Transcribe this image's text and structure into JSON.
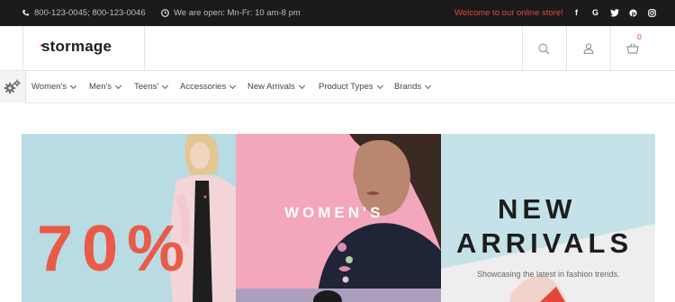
{
  "topbar": {
    "phones": "800-123-0045; 800-123-0046",
    "hours": "We are open: Mn-Fr: 10 am-8 pm",
    "welcome": "Welcome to our online store!",
    "socials": [
      "f",
      "G",
      "twitter",
      "pinterest",
      "instagram"
    ]
  },
  "header": {
    "logo": "stormage",
    "cart_count": "0",
    "icons": [
      "search-icon",
      "user-icon",
      "cart-icon"
    ]
  },
  "nav": {
    "items": [
      "Women's",
      "Men's",
      "Teens'",
      "Accessories",
      "New Arrivals",
      "Product Types",
      "Brands"
    ]
  },
  "banner": {
    "sale": "70%",
    "womens": "WOMEN'S",
    "new_line1": "NEW",
    "new_line2": "ARRIVALS",
    "tagline": "Showcasing the latest in fashion trends."
  },
  "colors": {
    "accent": "#e2473b",
    "topbar_bg": "#1b1b1b",
    "panel_left": "#b9dbe4",
    "panel_mid": "#f4a6bd",
    "panel_right": "#c4e2e8"
  }
}
